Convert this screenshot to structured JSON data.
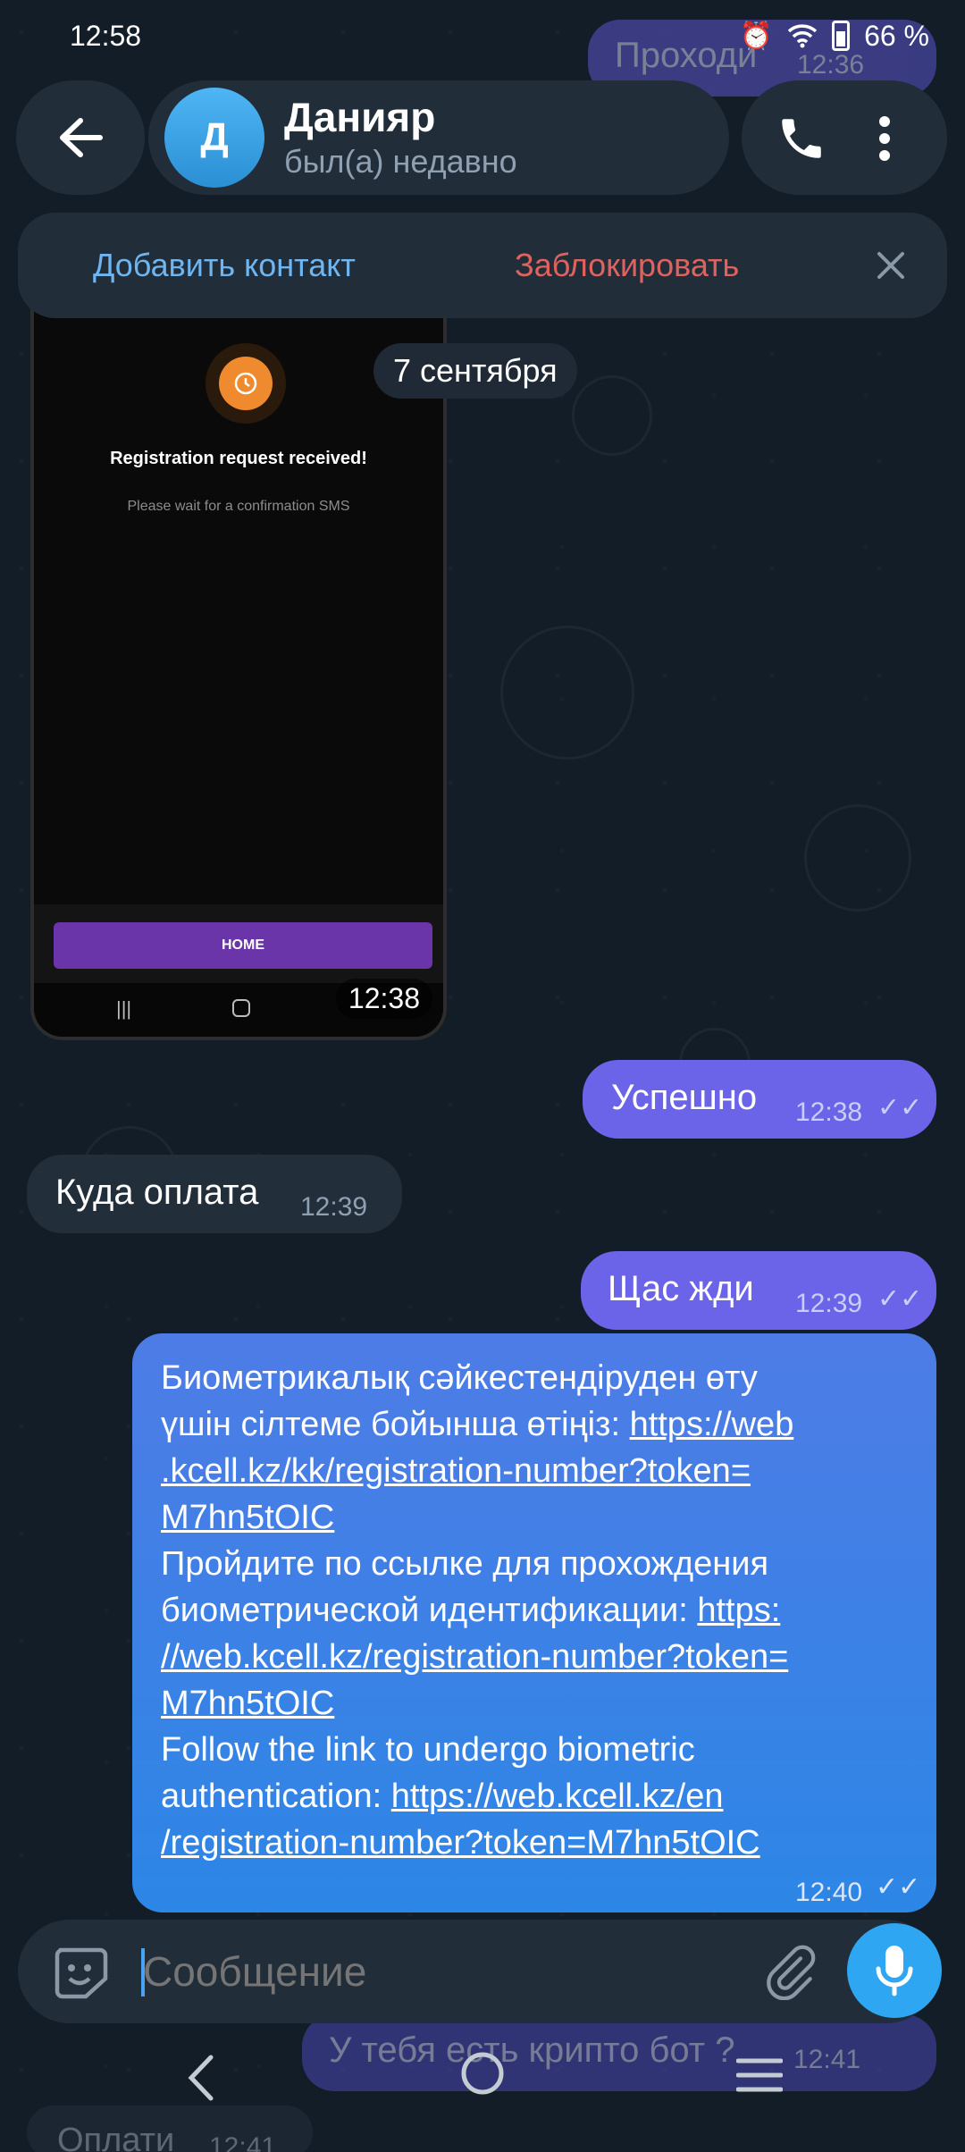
{
  "status_bar": {
    "time": "12:58",
    "battery": "66 %"
  },
  "header": {
    "avatar_letter": "Д",
    "name": "Данияр",
    "last_seen": "был(а) недавно"
  },
  "contact_bar": {
    "add_label": "Добавить контакт",
    "block_label": "Заблокировать"
  },
  "date_chip": "7 сентября",
  "screenshot_message": {
    "title": "Registration request received!",
    "subtitle": "Please wait for a confirmation SMS",
    "button": "HOME",
    "time": "12:38"
  },
  "messages": [
    {
      "text": "Успешно",
      "time": "12:38",
      "direction": "out"
    },
    {
      "text": "Куда оплата",
      "time": "12:39",
      "direction": "in"
    },
    {
      "text": "Щас жди",
      "time": "12:39",
      "direction": "out"
    }
  ],
  "long_message": {
    "line1": "Биометрикалық сәйкестендіруден өту",
    "line2a": "үшін сілтеме бойынша өтіңіз: ",
    "link1a": "https://web",
    "link1b": ".kcell.kz/kk/registration-number?token=",
    "link1c": "M7hn5tOIC",
    "line3": "Пройдите по ссылке для прохождения",
    "line4a": "биометрической идентификации: ",
    "link2a": "https:",
    "link2b": "//web.kcell.kz/registration-number?token=",
    "link2c": "M7hn5tOIC",
    "line5": "Follow the link to undergo biometric",
    "line6a": "authentication: ",
    "link3a": "https://web.kcell.kz/en",
    "link3b": "/registration-number?token=M7hn5tOIC",
    "time": "12:40"
  },
  "ghost_top": {
    "text": "Проходи",
    "time": "12:36"
  },
  "ghost_bottom": {
    "text": "У тебя есть крипто бот ?",
    "time": "12:41"
  },
  "ghost_bottom2": {
    "text": "Оплати",
    "time": "12:41"
  },
  "composer": {
    "placeholder": "Сообщение"
  },
  "colors": {
    "outgoing": "#6b63e8",
    "incoming": "#232e3b",
    "accent": "#2ea6f2"
  }
}
